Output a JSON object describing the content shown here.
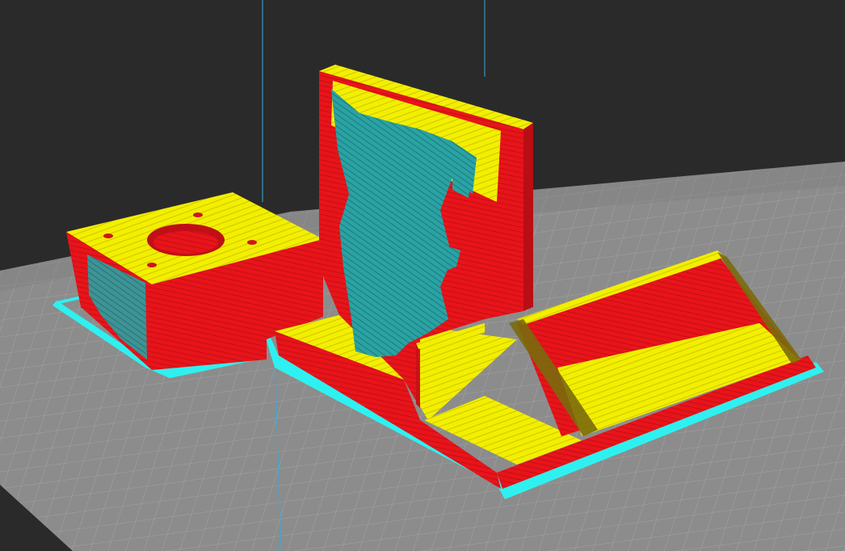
{
  "viewport": {
    "view": "layer-preview-3d",
    "colors": {
      "background": "#2a2a2b",
      "build_plate": "#8c8c8c",
      "build_plate_grid": "#a2a2a2",
      "wall_outer": "#e8141a",
      "infill_top": "#f2ef00",
      "support_tree": "#2aa2a4",
      "skirt_brim": "#2ff0f0",
      "axis_line": "#3aa9d8"
    }
  }
}
